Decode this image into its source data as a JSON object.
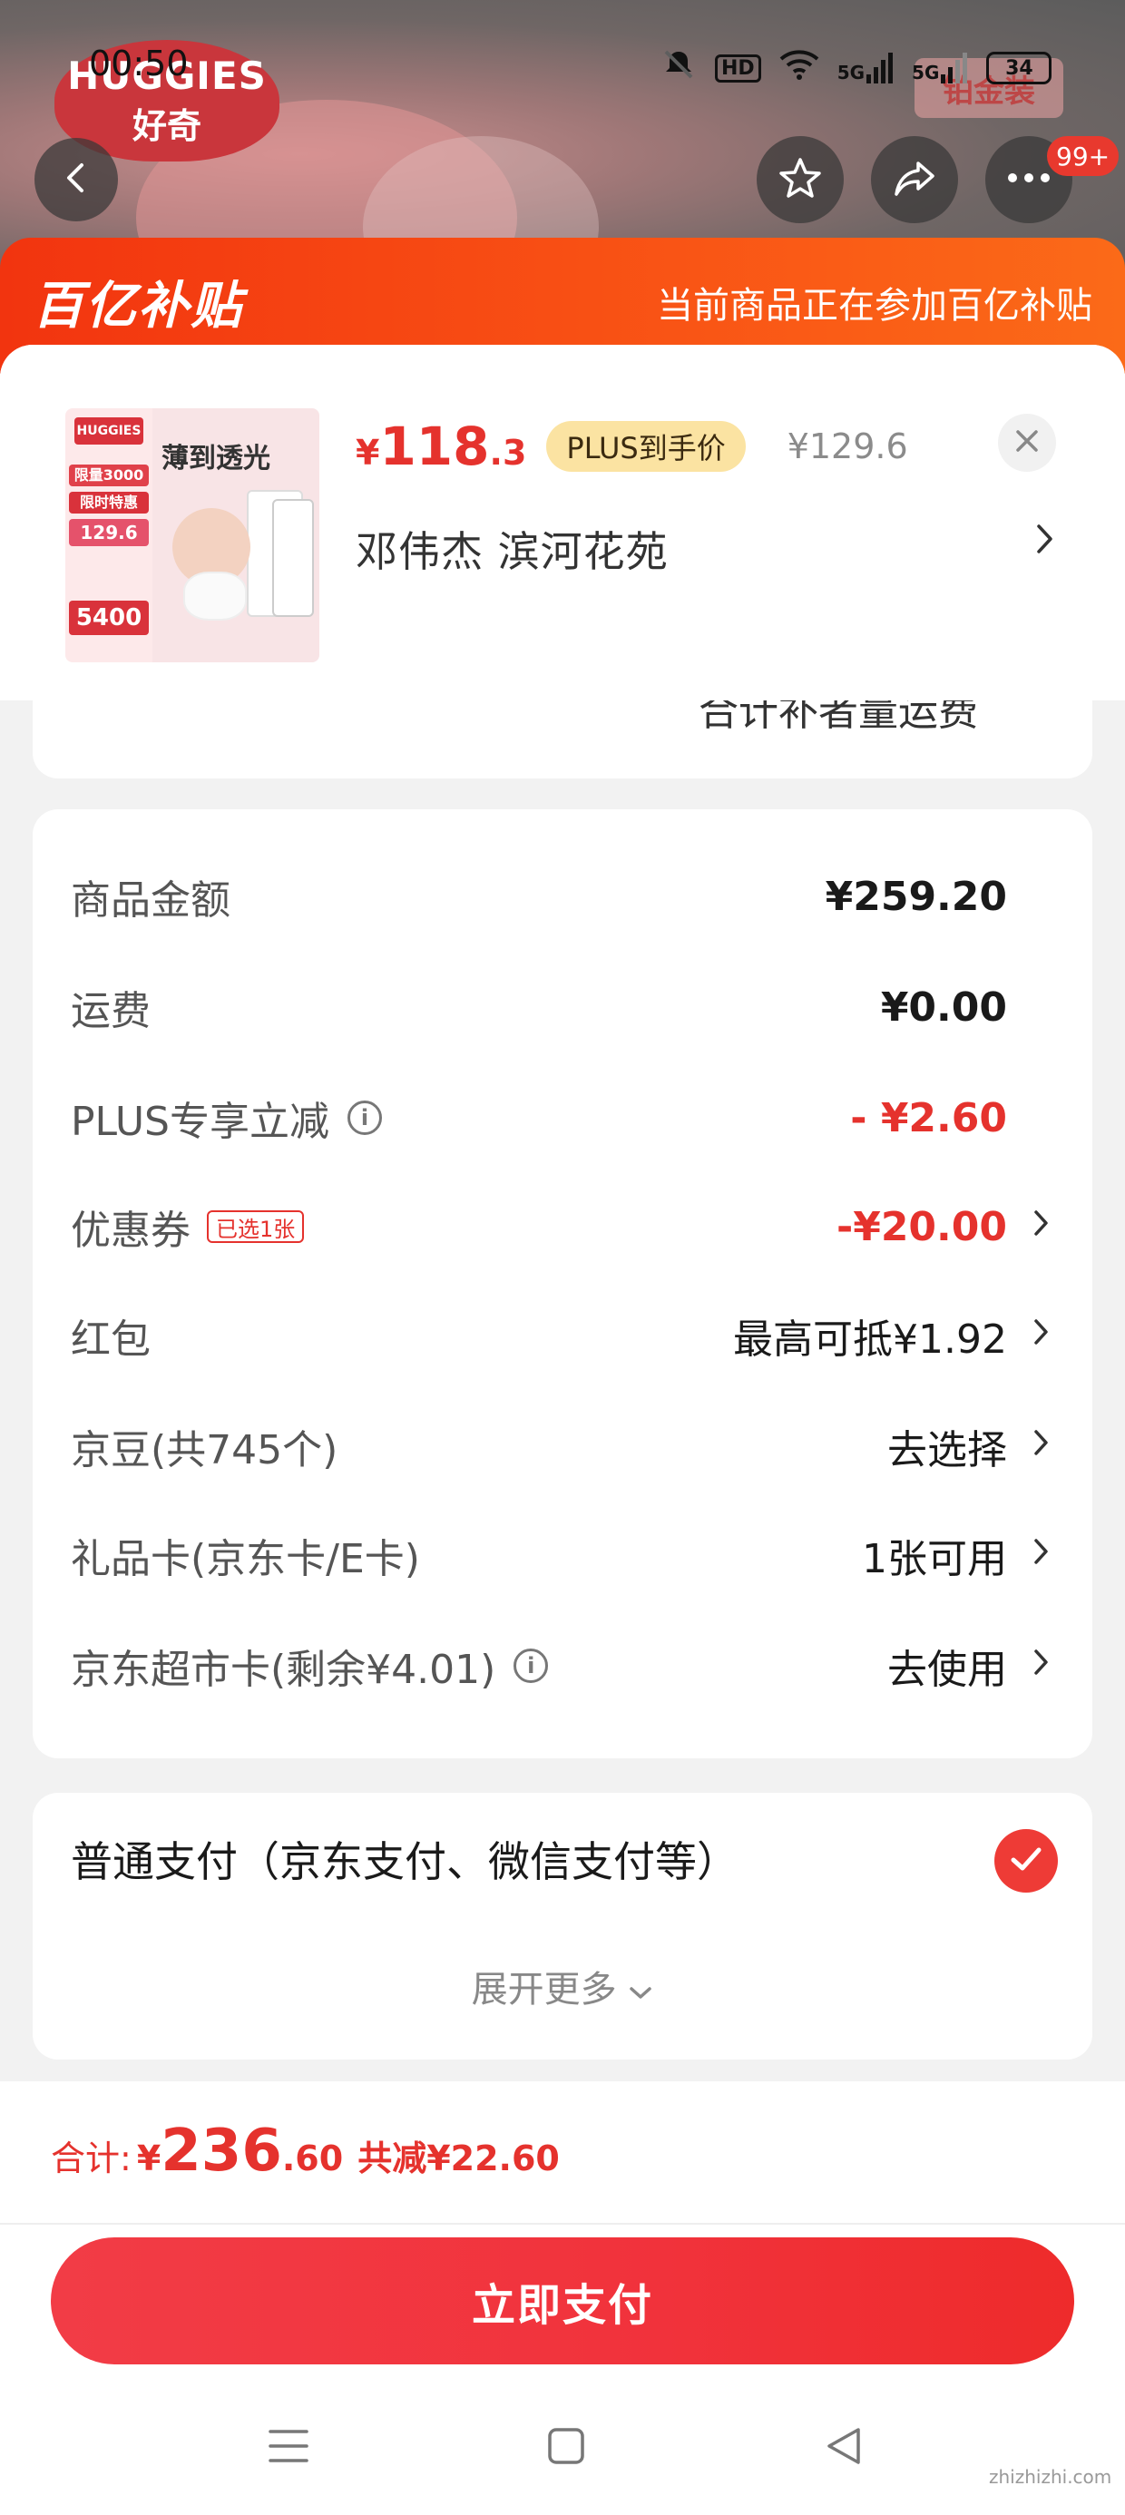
{
  "status_bar": {
    "time": "00:50",
    "network_1": "5G",
    "network_2": "5G",
    "battery": "34",
    "hd_label": "HD"
  },
  "background": {
    "brand_logo_line1": "HUGGIES",
    "brand_logo_line2": "好奇",
    "sticker_text": "铂金装"
  },
  "nav": {
    "more_badge": "99+"
  },
  "banner": {
    "logo_text": "百亿补贴",
    "message": "当前商品正在参加百亿补贴"
  },
  "product": {
    "thumb_title": "薄到透光",
    "thumb_tag_1": "限量3000",
    "thumb_tag_2": "限时特惠",
    "thumb_price_tag": "129.6",
    "thumb_tag_3": "5400",
    "price_symbol": "¥",
    "price_int": "118",
    "price_dec": ".3",
    "plus_label": "PLUS到手价",
    "original_price": "¥129.6",
    "address": "邓伟杰  滨河花苑"
  },
  "partial_text": "合计补者量运费",
  "fees": {
    "goods_amount_label": "商品金额",
    "goods_amount_value": "¥259.20",
    "shipping_label": "运费",
    "shipping_value": "¥0.00",
    "plus_discount_label": "PLUS专享立减",
    "plus_discount_value": "- ¥2.60",
    "coupon_label": "优惠券",
    "coupon_tag": "已选1张",
    "coupon_value": "-¥20.00",
    "redpacket_label": "红包",
    "redpacket_value": "最高可抵¥1.92",
    "jingdou_label": "京豆(共745个)",
    "jingdou_value": "去选择",
    "giftcard_label": "礼品卡(京东卡/E卡)",
    "giftcard_value": "1张可用",
    "supermarket_label": "京东超市卡(剩余¥4.01)",
    "supermarket_value": "去使用"
  },
  "payment": {
    "method": "普通支付（京东支付、微信支付等）",
    "expand": "展开更多"
  },
  "total": {
    "label": "合计:",
    "symbol": "¥",
    "int": "236",
    "dec": ".60",
    "saved": "共减¥22.60",
    "pay_button": "立即支付"
  },
  "watermark": "zhizhizhi.com",
  "colors": {
    "accent_red": "#e5322d",
    "banner_orange": "#f95415",
    "plus_gold": "#fbe3a2"
  },
  "icons": [
    "back-icon",
    "star-icon",
    "share-icon",
    "more-icon",
    "close-icon",
    "chevron-right-icon",
    "info-icon",
    "check-icon",
    "chevron-down-icon",
    "menu-icon",
    "home-icon",
    "back-triangle-icon"
  ]
}
